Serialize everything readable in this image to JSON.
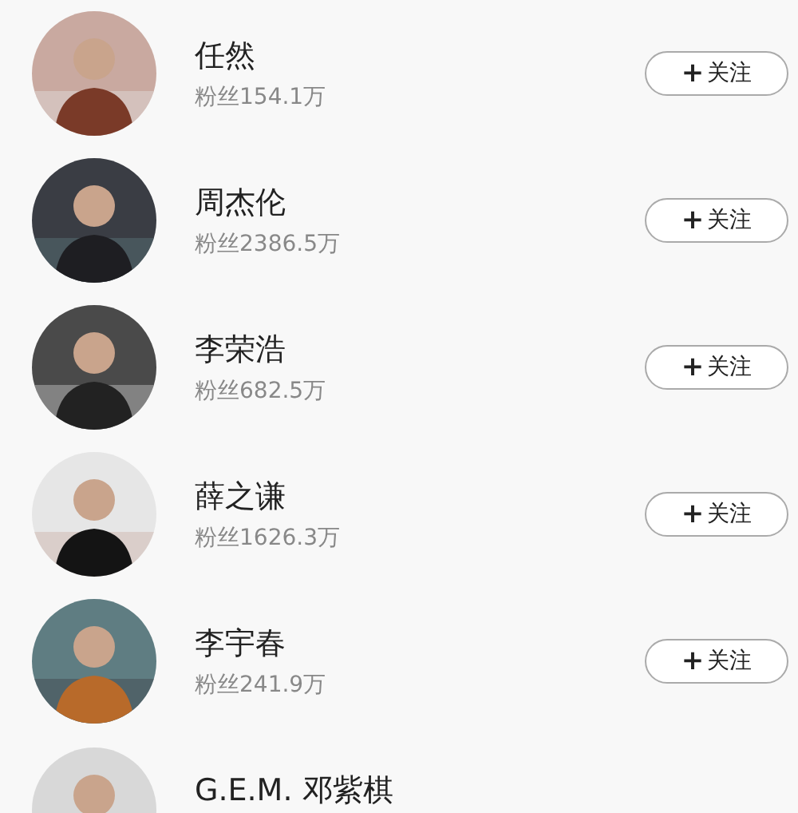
{
  "users": [
    {
      "name": "任然",
      "fans": "粉丝154.1万",
      "follow": {
        "icon": "+",
        "label": "关注"
      }
    },
    {
      "name": "周杰伦",
      "fans": "粉丝2386.5万",
      "follow": {
        "icon": "+",
        "label": "关注"
      }
    },
    {
      "name": "李荣浩",
      "fans": "粉丝682.5万",
      "follow": {
        "icon": "+",
        "label": "关注"
      }
    },
    {
      "name": "薛之谦",
      "fans": "粉丝1626.3万",
      "follow": {
        "icon": "+",
        "label": "关注"
      }
    },
    {
      "name": "李宇春",
      "fans": "粉丝241.9万",
      "follow": {
        "icon": "+",
        "label": "关注"
      }
    },
    {
      "name": "G.E.M. 邓紫棋"
    }
  ]
}
